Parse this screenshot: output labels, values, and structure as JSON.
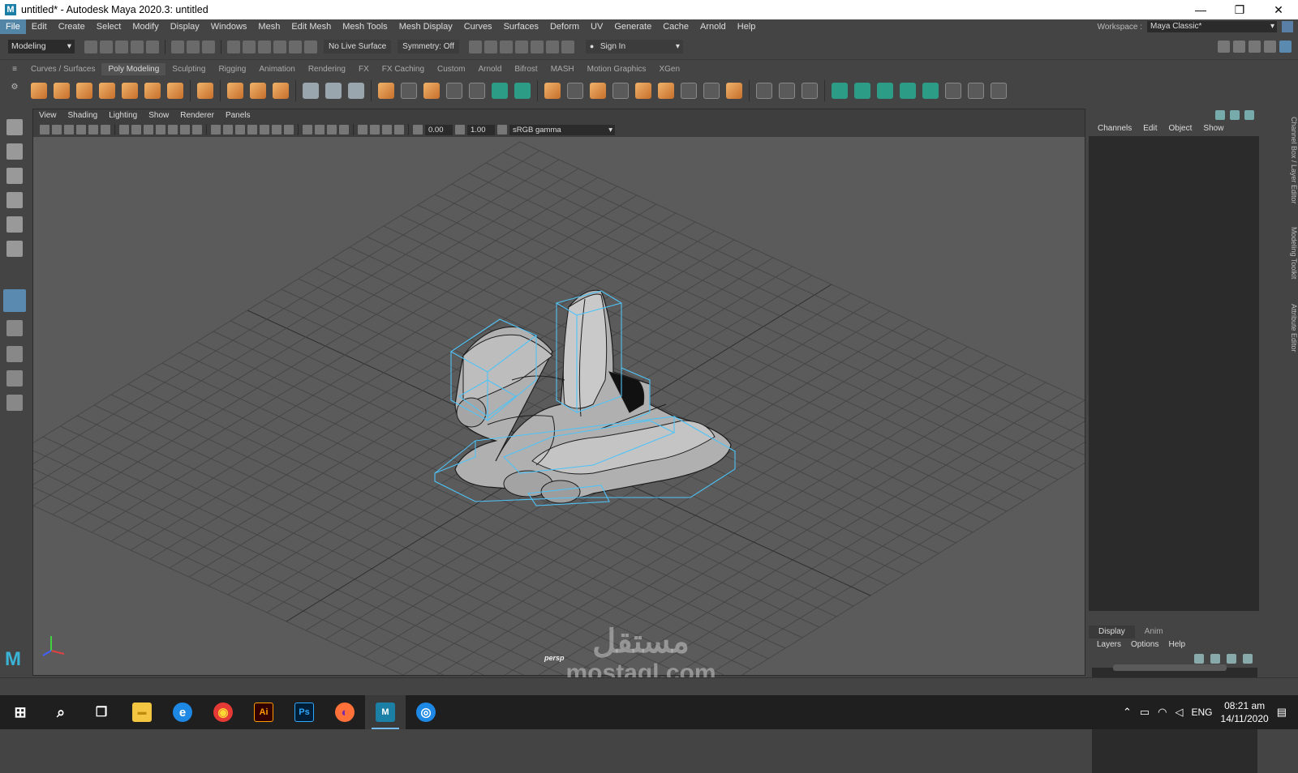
{
  "window": {
    "title": "untitled* - Autodesk Maya 2020.3: untitled",
    "app_letter": "M"
  },
  "window_controls": {
    "minimize": "—",
    "maximize": "❐",
    "close": "✕"
  },
  "menu": [
    "File",
    "Edit",
    "Create",
    "Select",
    "Modify",
    "Display",
    "Windows",
    "Mesh",
    "Edit Mesh",
    "Mesh Tools",
    "Mesh Display",
    "Curves",
    "Surfaces",
    "Deform",
    "UV",
    "Generate",
    "Cache",
    "Arnold",
    "Help"
  ],
  "workspace": {
    "label": "Workspace :",
    "value": "Maya Classic*"
  },
  "status_line": {
    "mode": "Modeling",
    "live_surface": "No Live Surface",
    "symmetry": "Symmetry: Off",
    "sign_in": "Sign In"
  },
  "shelf_tabs": [
    "Curves / Surfaces",
    "Poly Modeling",
    "Sculpting",
    "Rigging",
    "Animation",
    "Rendering",
    "FX",
    "FX Caching",
    "Custom",
    "Arnold",
    "Bifrost",
    "MASH",
    "Motion Graphics",
    "XGen"
  ],
  "shelf_active": "Poly Modeling",
  "viewport_menu": [
    "View",
    "Shading",
    "Lighting",
    "Show",
    "Renderer",
    "Panels"
  ],
  "viewport_fields": {
    "exposure": "0.00",
    "gamma": "1.00",
    "color_space": "sRGB gamma"
  },
  "camera_label": "persp",
  "channel_box": {
    "menu": [
      "Channels",
      "Edit",
      "Object",
      "Show"
    ]
  },
  "layer_editor": {
    "tabs": [
      "Display",
      "Anim"
    ],
    "menu": [
      "Layers",
      "Options",
      "Help"
    ]
  },
  "side_tabs": [
    "Channel Box / Layer Editor",
    "Modeling Toolkit",
    "Attribute Editor"
  ],
  "watermark": {
    "arabic": "مستقل",
    "latin": "mostaql.com"
  },
  "taskbar": {
    "apps": [
      {
        "name": "start",
        "glyph": "⊞"
      },
      {
        "name": "search",
        "glyph": "⌕"
      },
      {
        "name": "task-view",
        "glyph": "❒"
      },
      {
        "name": "file-explorer",
        "glyph": "▬"
      },
      {
        "name": "edge",
        "glyph": "e"
      },
      {
        "name": "chrome",
        "glyph": "◉"
      },
      {
        "name": "illustrator",
        "glyph": "Ai"
      },
      {
        "name": "photoshop",
        "glyph": "Ps"
      },
      {
        "name": "firefox",
        "glyph": "◐"
      },
      {
        "name": "maya",
        "glyph": "M"
      },
      {
        "name": "whatsapp",
        "glyph": "◎"
      }
    ],
    "language": "ENG",
    "time": "08:21 am",
    "date": "14/11/2020"
  },
  "colors": {
    "accent": "#5285a6",
    "selection_wire": "#4fc3f7",
    "viewport_bg": "#5b5b5b"
  }
}
